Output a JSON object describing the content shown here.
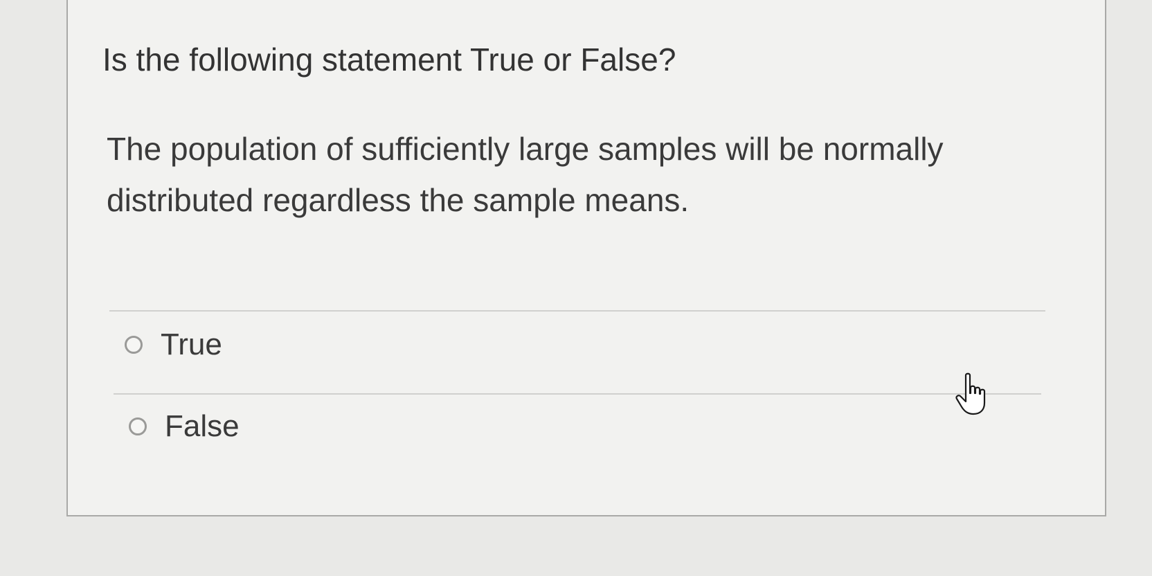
{
  "question": {
    "title": "Is the following statement True or False?",
    "statement": "The population of sufficiently large samples will be normally distributed regardless the sample means."
  },
  "options": [
    {
      "label": "True",
      "selected": false
    },
    {
      "label": "False",
      "selected": false
    }
  ],
  "cursor": {
    "icon": "hand-pointer-icon"
  }
}
